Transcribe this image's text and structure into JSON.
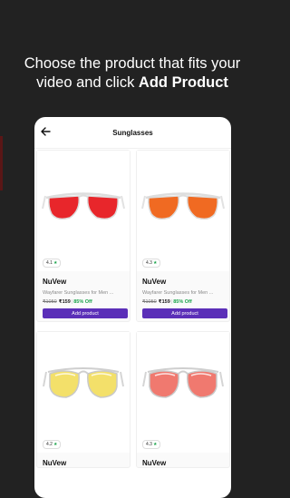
{
  "headline": {
    "line1": "Choose the product that fits your",
    "line2_prefix": "video and click ",
    "line2_strong": "Add Product"
  },
  "screen": {
    "title": "Sunglasses",
    "back_icon": "arrow-left-icon"
  },
  "products": [
    {
      "rating": "4.1",
      "brand": "NuVew",
      "name": "Wayfarer Sunglasses for Men ...",
      "mrp": "₹1050",
      "price": "₹159",
      "discount": "85% Off",
      "button": "Add product",
      "lens_color": "#e8262b"
    },
    {
      "rating": "4.3",
      "brand": "NuVew",
      "name": "Wayfarer Sunglasses for Men ...",
      "mrp": "₹1050",
      "price": "₹159",
      "discount": "85% Off",
      "button": "Add product",
      "lens_color": "#f06a22"
    },
    {
      "rating": "4.2",
      "brand": "NuVew",
      "name": "",
      "mrp": "",
      "price": "",
      "discount": "",
      "button": "",
      "lens_color": "#f3e06a"
    },
    {
      "rating": "4.3",
      "brand": "NuVew",
      "name": "",
      "mrp": "",
      "price": "",
      "discount": "",
      "button": "",
      "lens_color": "#f0796f"
    }
  ],
  "colors": {
    "background": "#222222",
    "button": "#5b2fb8",
    "discount": "#1aa34a"
  }
}
